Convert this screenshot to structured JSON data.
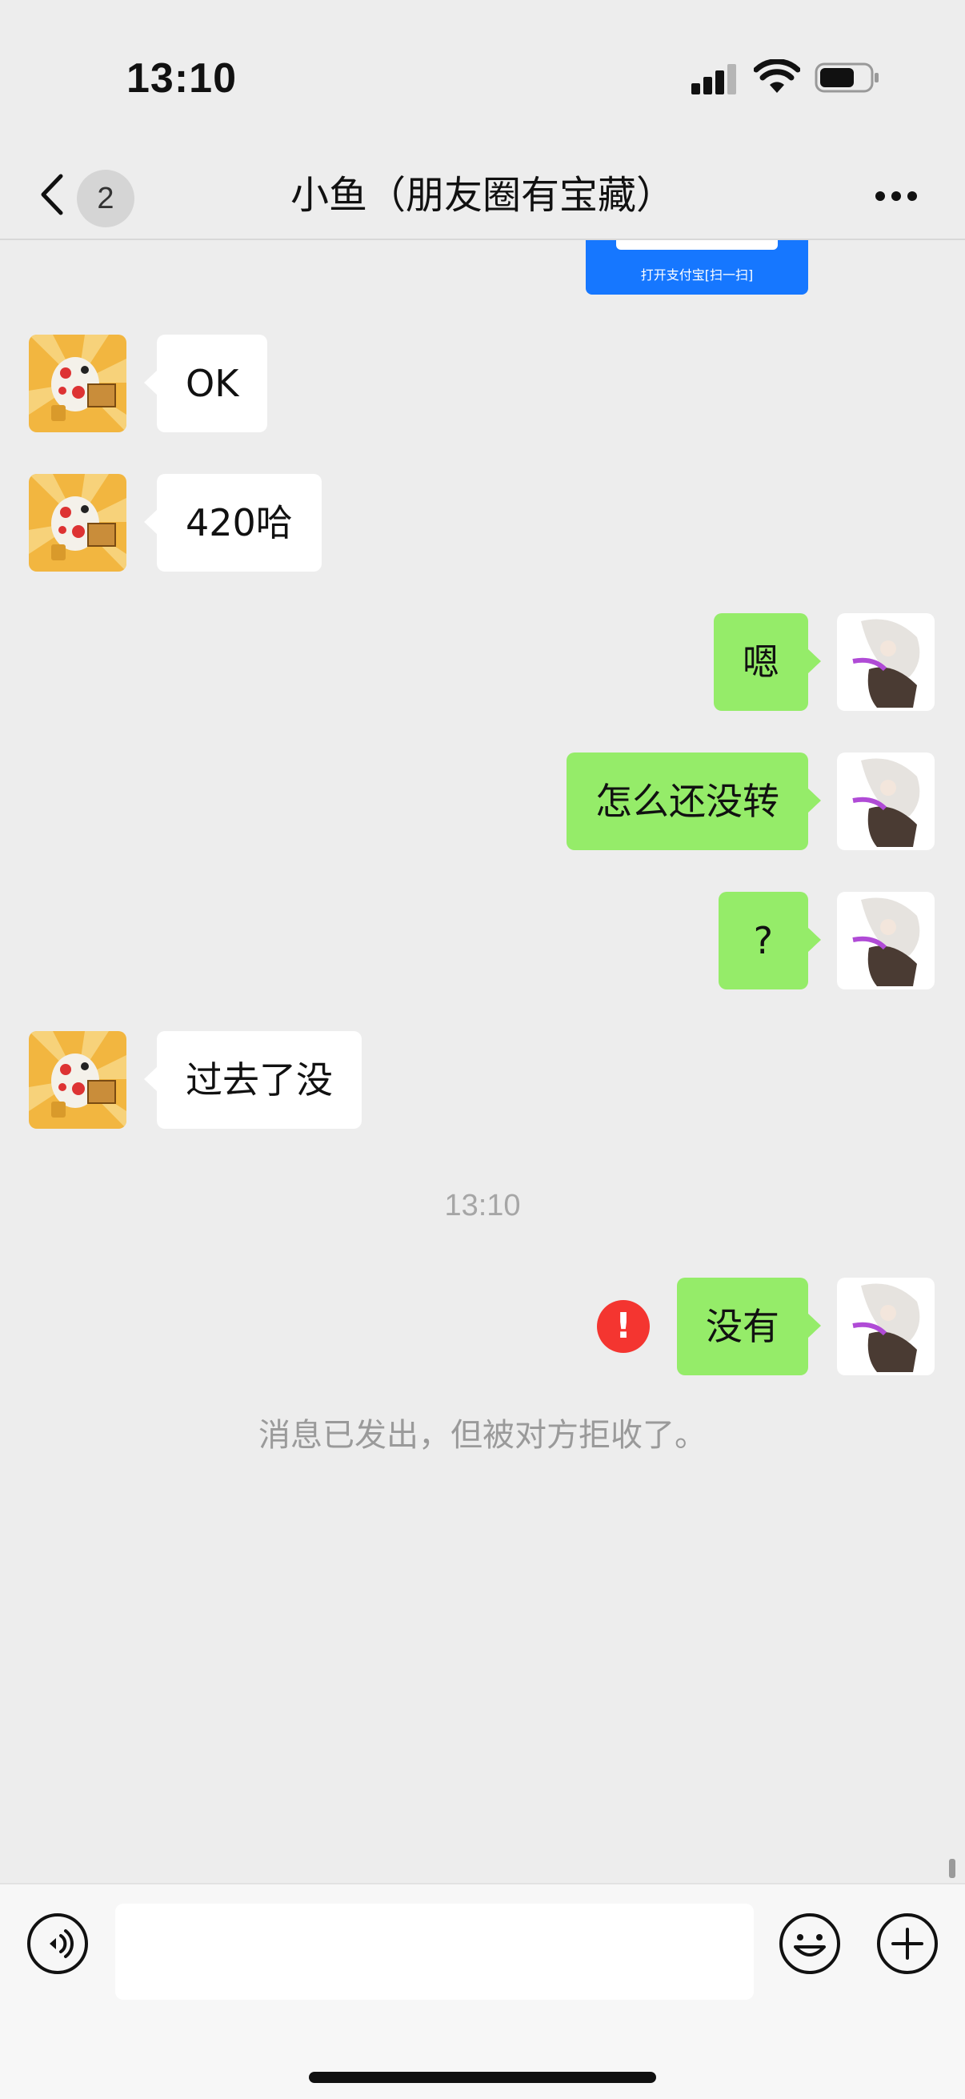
{
  "status_bar": {
    "time": "13:10",
    "battery_level": 0.7
  },
  "header": {
    "unread_count": "2",
    "title": "小鱼（朋友圈有宝藏）"
  },
  "pay_card": {
    "text": "打开支付宝[扫一扫]"
  },
  "messages": [
    {
      "side": "in",
      "text": "OK"
    },
    {
      "side": "in",
      "text": "420哈"
    },
    {
      "side": "out",
      "text": "嗯"
    },
    {
      "side": "out",
      "text": "怎么还没转"
    },
    {
      "side": "out",
      "text": "?"
    },
    {
      "side": "in",
      "text": "过去了没"
    }
  ],
  "timestamp": "13:10",
  "failed_message": {
    "side": "out",
    "text": "没有",
    "error_icon_text": "!"
  },
  "system_note": "消息已发出，但被对方拒收了。",
  "colors": {
    "outgoing_bubble": "#95ec69",
    "incoming_bubble": "#ffffff",
    "error": "#f43530",
    "pay_blue": "#1677ff"
  },
  "icons": {
    "back": "chevron-left-icon",
    "more": "more-dots-icon",
    "voice": "voice-icon",
    "emoji": "emoji-icon",
    "plus": "plus-icon"
  }
}
